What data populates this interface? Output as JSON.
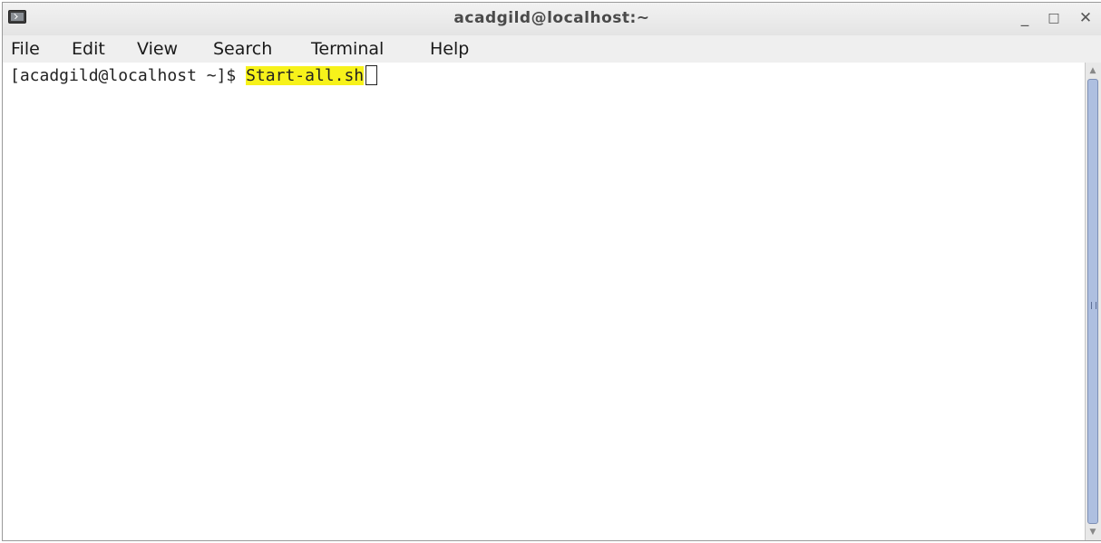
{
  "window": {
    "title": "acadgild@localhost:~",
    "controls": {
      "minimize": "_",
      "maximize": "□",
      "close": "✕"
    }
  },
  "menu": {
    "items": [
      "File",
      "Edit",
      "View",
      "Search",
      "Terminal",
      "Help"
    ]
  },
  "terminal": {
    "prompt": "[acadgild@localhost ~]$ ",
    "command": "Start-all.sh",
    "highlight_color": "#f7f21a"
  },
  "scrollbar": {
    "thumb_color": "#aebfe0"
  }
}
